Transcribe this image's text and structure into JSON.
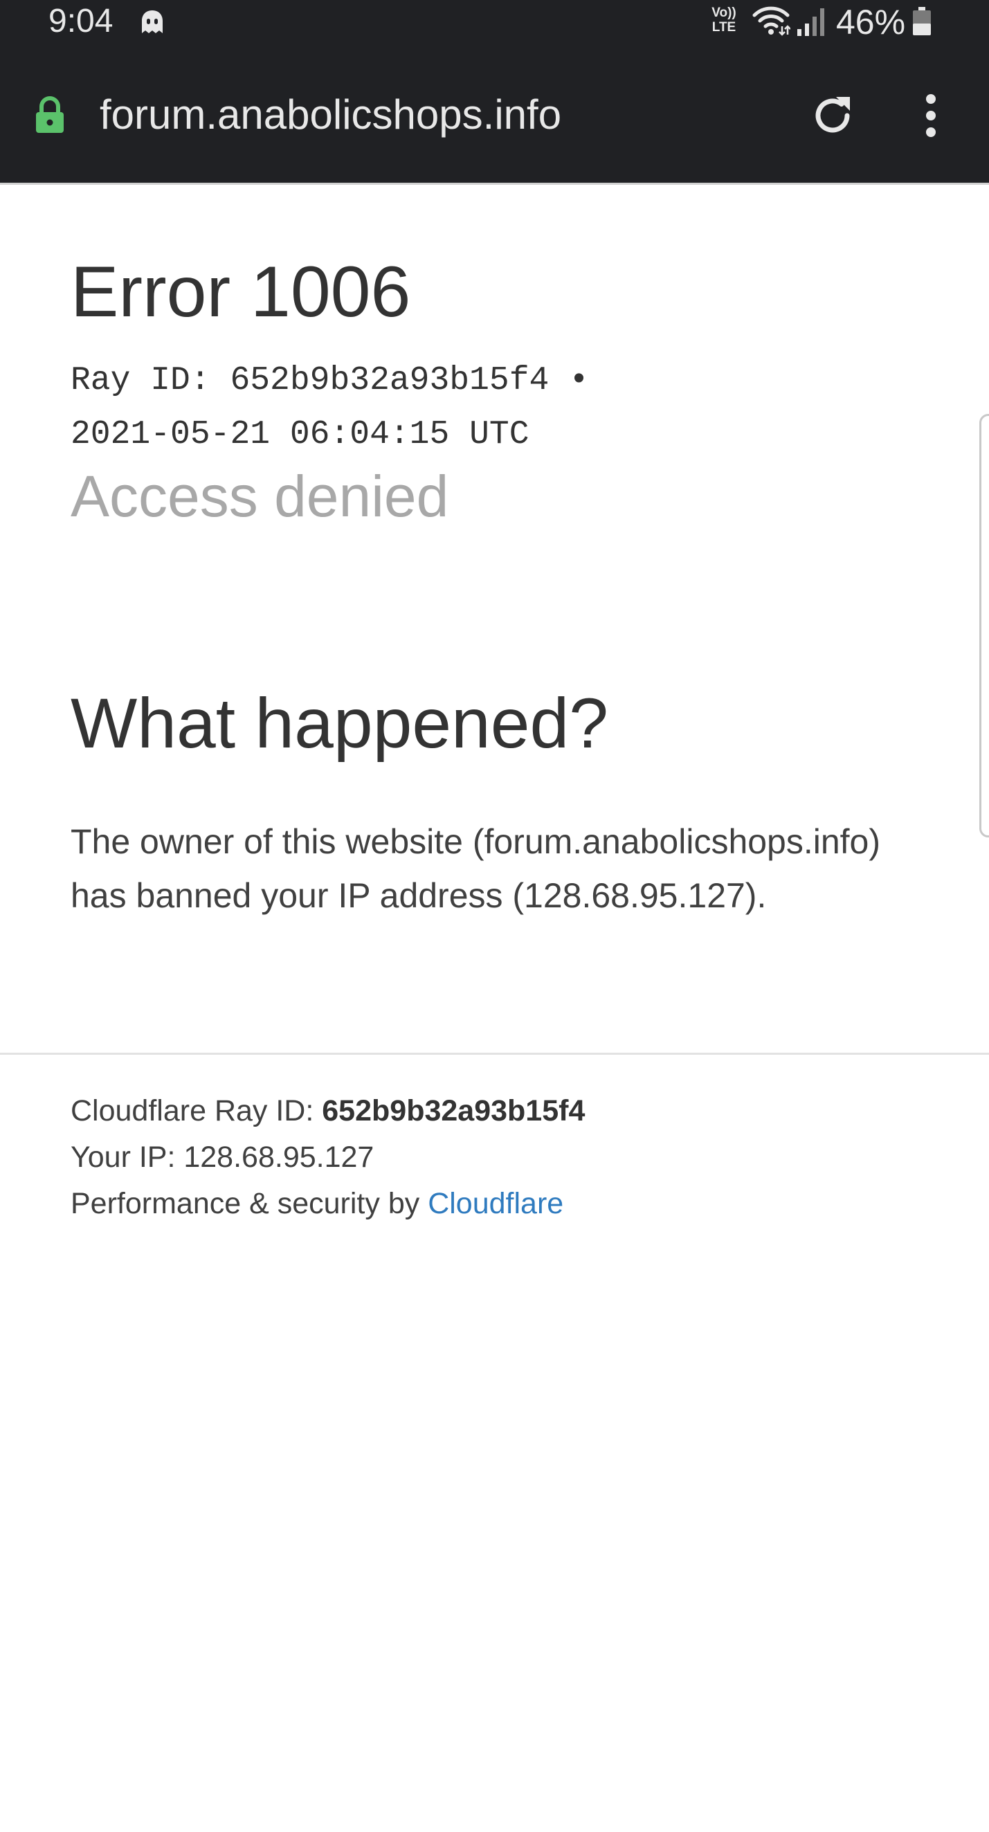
{
  "status_bar": {
    "time": "9:04",
    "volte_top": "Vo))",
    "volte_bottom": "LTE",
    "battery_percent": "46%",
    "battery_level": 0.46,
    "icons": [
      "ghost-icon",
      "volte-icon",
      "wifi-icon",
      "signal-icon",
      "battery-icon"
    ]
  },
  "browser": {
    "url": "forum.anabolicshops.info",
    "lock_color": "#5bc26b",
    "icons": [
      "lock-icon",
      "reload-icon",
      "more-vert-icon"
    ]
  },
  "error": {
    "title": "Error 1006",
    "ray_line_1": "Ray ID: 652b9b32a93b15f4 •",
    "ray_line_2": "2021-05-21 06:04:15 UTC",
    "subtitle": "Access denied"
  },
  "what_happened": {
    "heading": "What happened?",
    "text": "The owner of this website (forum.anabolicshops.info) has banned your IP address (128.68.95.127)."
  },
  "footer": {
    "ray_label": "Cloudflare Ray ID: ",
    "ray_value": "652b9b32a93b15f4",
    "ip_text": "Your IP: 128.68.95.127",
    "perf_label": "Performance & security by ",
    "cloudflare_link": "Cloudflare",
    "link_color": "#2f7bbf"
  }
}
